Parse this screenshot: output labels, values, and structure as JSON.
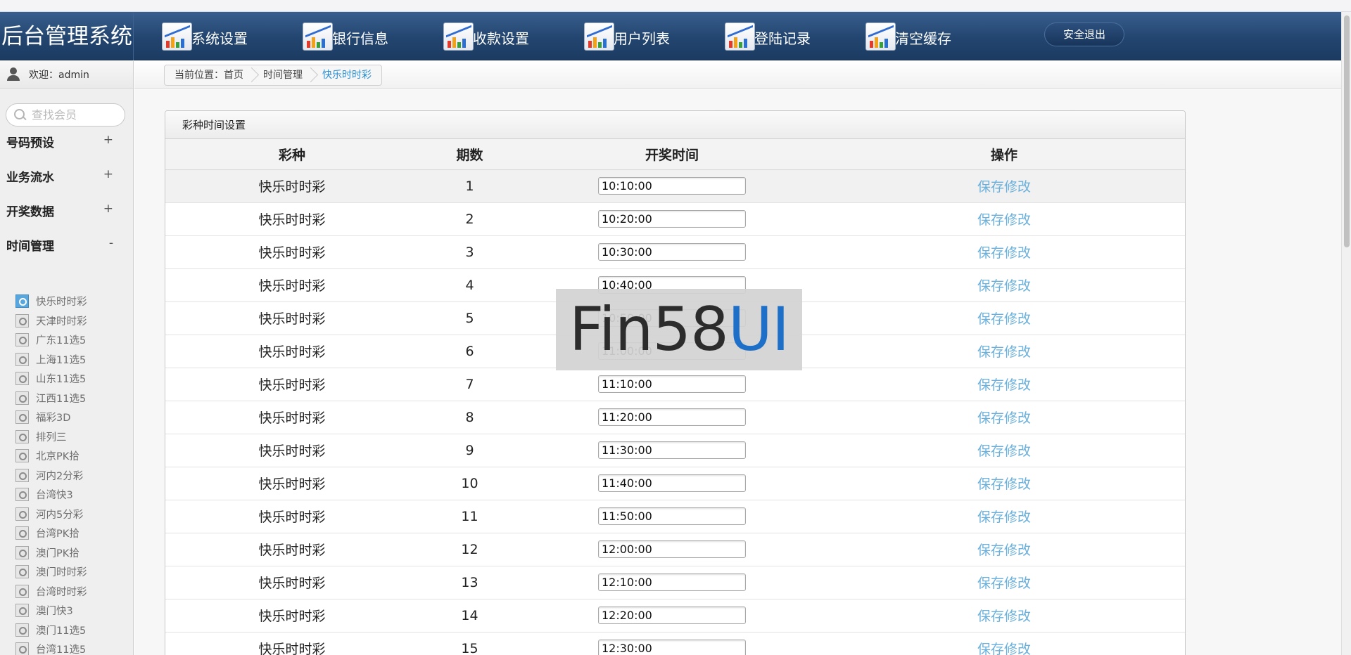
{
  "header": {
    "title": "后台管理系统",
    "nav": [
      "系统设置",
      "银行信息",
      "收款设置",
      "用户列表",
      "登陆记录",
      "清空缓存"
    ],
    "logout": "安全退出"
  },
  "sidebar": {
    "welcome": "欢迎：admin",
    "search_placeholder": "查找会员",
    "sections": [
      {
        "label": "号码预设",
        "toggle": "+"
      },
      {
        "label": "业务流水",
        "toggle": "+"
      },
      {
        "label": "开奖数据",
        "toggle": "+"
      },
      {
        "label": "时间管理",
        "toggle": "-"
      }
    ],
    "sub_items": [
      "快乐时时彩",
      "天津时时彩",
      "广东11选5",
      "上海11选5",
      "山东11选5",
      "江西11选5",
      "福彩3D",
      "排列三",
      "北京PK拾",
      "河内2分彩",
      "台湾快3",
      "河内5分彩",
      "台湾PK拾",
      "澳门PK拾",
      "澳门时时彩",
      "台湾时时彩",
      "澳门快3",
      "澳门11选5",
      "台湾11选5"
    ]
  },
  "breadcrumb": {
    "prefix": "当前位置：首页",
    "parent": "时间管理",
    "current": "快乐时时彩"
  },
  "panel": {
    "title": "彩种时间设置",
    "columns": [
      "彩种",
      "期数",
      "开奖时间",
      "操作"
    ],
    "action_label": "保存修改",
    "rows": [
      {
        "name": "快乐时时彩",
        "issue": "1",
        "time": "10:10:00"
      },
      {
        "name": "快乐时时彩",
        "issue": "2",
        "time": "10:20:00"
      },
      {
        "name": "快乐时时彩",
        "issue": "3",
        "time": "10:30:00"
      },
      {
        "name": "快乐时时彩",
        "issue": "4",
        "time": "10:40:00"
      },
      {
        "name": "快乐时时彩",
        "issue": "5",
        "time": "10:50:00"
      },
      {
        "name": "快乐时时彩",
        "issue": "6",
        "time": "11:00:00"
      },
      {
        "name": "快乐时时彩",
        "issue": "7",
        "time": "11:10:00"
      },
      {
        "name": "快乐时时彩",
        "issue": "8",
        "time": "11:20:00"
      },
      {
        "name": "快乐时时彩",
        "issue": "9",
        "time": "11:30:00"
      },
      {
        "name": "快乐时时彩",
        "issue": "10",
        "time": "11:40:00"
      },
      {
        "name": "快乐时时彩",
        "issue": "11",
        "time": "11:50:00"
      },
      {
        "name": "快乐时时彩",
        "issue": "12",
        "time": "12:00:00"
      },
      {
        "name": "快乐时时彩",
        "issue": "13",
        "time": "12:10:00"
      },
      {
        "name": "快乐时时彩",
        "issue": "14",
        "time": "12:20:00"
      },
      {
        "name": "快乐时时彩",
        "issue": "15",
        "time": "12:30:00"
      }
    ]
  },
  "watermark": {
    "dark": "Fin58",
    "blue": "UI"
  },
  "colors": {
    "header": "#22456f",
    "link": "#6ab0dc",
    "active_crumb": "#2b8dd0"
  }
}
